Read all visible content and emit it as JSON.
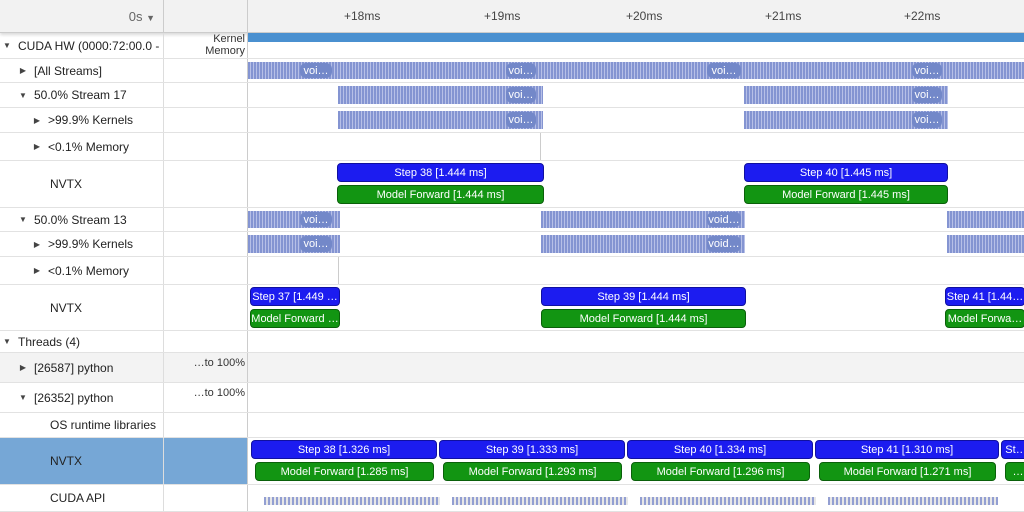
{
  "header": {
    "time_origin": "0s",
    "ticks": [
      "+18ms",
      "+19ms",
      "+20ms",
      "+21ms",
      "+22ms"
    ]
  },
  "rows": {
    "cuda_hw": {
      "label": "CUDA HW (0000:72:00.0 -",
      "legend_kernel": "Kernel",
      "legend_memory": "Memory"
    },
    "all_streams": {
      "label": "[All Streams]",
      "chip": "voi…"
    },
    "stream17": {
      "label": "50.0% Stream 17",
      "kernels": ">99.9% Kernels",
      "memory": "<0.1% Memory",
      "nvtx": "NVTX",
      "chip": "voi…"
    },
    "stream17_nvtx": {
      "steps": [
        "Step 38 [1.444 ms]",
        "Step 40 [1.445 ms]"
      ],
      "forwards": [
        "Model Forward [1.444 ms]",
        "Model Forward [1.445 ms]"
      ]
    },
    "stream13": {
      "label": "50.0% Stream 13",
      "kernels": ">99.9% Kernels",
      "memory": "<0.1% Memory",
      "nvtx": "NVTX",
      "chip_a": "voi…",
      "chip_b": "void…"
    },
    "stream13_nvtx": {
      "steps": [
        "Step 37 [1.449 …",
        "Step 39 [1.444 ms]",
        "Step 41 [1.44…"
      ],
      "forwards": [
        "Model Forward …",
        "Model Forward [1.444 ms]",
        "Model Forwa…"
      ]
    },
    "threads": {
      "label": "Threads (4)"
    },
    "t26587": {
      "label": "[26587] python",
      "scale": "…to 100%"
    },
    "t26352": {
      "label": "[26352] python",
      "scale": "…to 100%"
    },
    "os_rt": {
      "label": "OS runtime libraries"
    },
    "thread_nvtx": {
      "label": "NVTX",
      "steps": [
        "Step 38 [1.326 ms]",
        "Step 39 [1.333 ms]",
        "Step 40 [1.334 ms]",
        "Step 41 [1.310 ms]",
        "St…"
      ],
      "forwards": [
        "Model Forward [1.285 ms]",
        "Model Forward [1.293 ms]",
        "Model Forward [1.296 ms]",
        "Model Forward [1.271 ms]",
        "…"
      ]
    },
    "cuda_api": {
      "label": "CUDA API"
    }
  },
  "colors": {
    "step": "#1c1cf0",
    "forward": "#129512",
    "kernel": "#7d8fcf",
    "selected_row": "#76a7d6"
  }
}
